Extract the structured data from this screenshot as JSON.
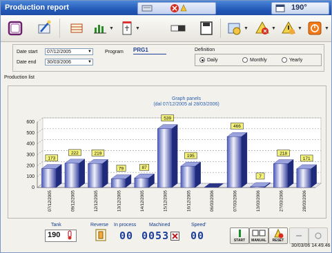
{
  "window": {
    "title": "Production report",
    "clock_value": "190°"
  },
  "params": {
    "date_start_label": "Date start",
    "date_start": "07/12/2005",
    "date_end_label": "Date end",
    "date_end": "30/03/2006",
    "program_label": "Program",
    "program": "PRG1",
    "definition_label": "Definition",
    "options": [
      "Daily",
      "Monthly",
      "Yearly"
    ],
    "selected": "Daily"
  },
  "list_label": "Production list",
  "chart_data": {
    "type": "bar",
    "title": "Graph panels",
    "subtitle": "(dal 07/12/2005 al 28/03/2006)",
    "categories": [
      "07/12/2005",
      "09/12/2005",
      "12/12/2005",
      "13/12/2005",
      "14/12/2005",
      "15/12/2005",
      "16/12/2005",
      "06/03/2006",
      "07/03/2006",
      "13/03/2006",
      "27/03/2006",
      "28/03/2006"
    ],
    "values": [
      173,
      222,
      219,
      79,
      87,
      539,
      195,
      0,
      466,
      7,
      218,
      171
    ],
    "data_labels": [
      "173",
      "222",
      "219",
      "79",
      "87",
      "539",
      "195",
      "",
      "466",
      "7",
      "218",
      "171"
    ],
    "ylim": [
      0,
      600
    ],
    "yticks": [
      0,
      100,
      200,
      300,
      400,
      500,
      600
    ],
    "grid": true
  },
  "status": {
    "tank_label": "Tank",
    "tank_value": "190",
    "reverse_label": "Reverse",
    "in_process_label": "In process",
    "in_process_value": "00",
    "machined_label": "Machined",
    "machined_value": "0053",
    "speed_label": "Speed'",
    "speed_value": "00",
    "start_label": "START",
    "manual_label": "MANUAL",
    "reset_label": "RESET",
    "datetime": "30/03/06 14.49.46"
  }
}
